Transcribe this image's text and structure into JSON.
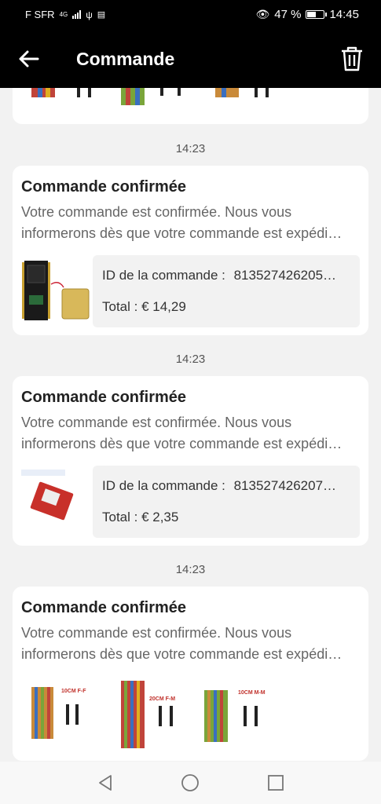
{
  "status_bar": {
    "carrier": "F SFR",
    "network": "4G",
    "battery": "47 %",
    "battery_level": 0.47,
    "time": "14:45"
  },
  "header": {
    "title": "Commande",
    "back_icon": "arrow-left-icon",
    "delete_icon": "trash-icon"
  },
  "messages": [
    {
      "time": "14:23",
      "title": "Commande confirmée",
      "desc_line1": "Votre commande est confirmée. Nous vous",
      "desc_line2": "informerons dès que votre commande est expédi…",
      "order_id_label": "ID de la commande :",
      "order_id": "813527426205…",
      "total": "Total : € 14,29"
    },
    {
      "time": "14:23",
      "title": "Commande confirmée",
      "desc_line1": "Votre commande est confirmée. Nous vous",
      "desc_line2": "informerons dès que votre commande est expédi…",
      "order_id_label": "ID de la commande :",
      "order_id": "813527426207…",
      "total": "Total : € 2,35"
    },
    {
      "time": "14:23",
      "title": "Commande confirmée",
      "desc_line1": "Votre commande est confirmée. Nous vous",
      "desc_line2": "informerons dès que votre commande est expédi…",
      "product_labels": [
        "10CM F-F",
        "20CM F-M",
        "10CM M-M"
      ]
    }
  ],
  "colors": {
    "header_bg": "#000000",
    "page_bg": "#f2f2f2",
    "card_bg": "#ffffff",
    "text_dark": "#222222",
    "text_gray": "#666666"
  }
}
